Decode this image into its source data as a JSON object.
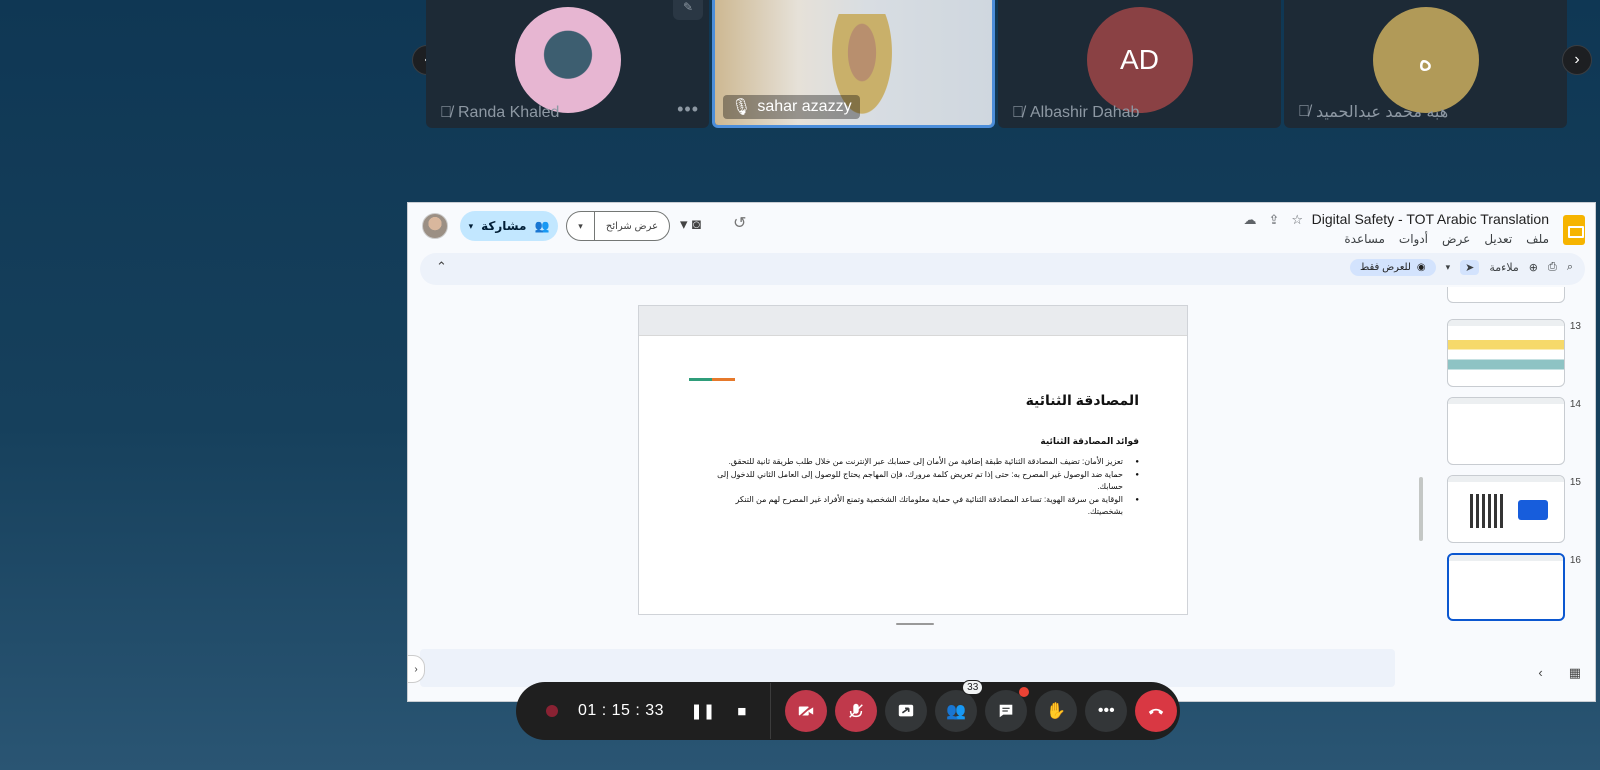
{
  "participants": [
    {
      "name": "Randa Khaled",
      "muted": true,
      "type": "photo"
    },
    {
      "name": "sahar azazzy",
      "muted": false,
      "type": "video",
      "active": true
    },
    {
      "name": "Albashir Dahab",
      "muted": true,
      "type": "initials",
      "initials": "AD",
      "color": "#8a4144"
    },
    {
      "name": "هبه محمد عبدالحميد",
      "muted": true,
      "type": "initials",
      "initials": "ه",
      "color": "#b19a58"
    }
  ],
  "slides_app": {
    "title": "Digital Safety - TOT Arabic Translation",
    "menu": [
      "ملف",
      "تعديل",
      "عرض",
      "أدوات",
      "مساعدة"
    ],
    "share_label": "مشاركة",
    "present_label": "عرض شرائح",
    "view_only_label": "للعرض فقط",
    "fit_label": "ملاءمة"
  },
  "slide": {
    "title": "المصادقة الثنائية",
    "subtitle": "فوائد المصادقة الثنائية",
    "bullets": [
      "تعزيز الأمان: تضيف المصادقة الثنائية طبقة إضافية من الأمان إلى حسابك عبر الإنترنت من خلال طلب طريقة ثانية للتحقق.",
      "حماية ضد الوصول غير المصرح به: حتى إذا تم تعريض كلمة مرورك، فإن المهاجم يحتاج للوصول إلى العامل الثاني للدخول إلى حسابك.",
      "الوقاية من سرقة الهوية: تساعد المصادقة الثنائية في حماية معلوماتك الشخصية وتمنع الأفراد غير المصرح لهم من التنكر بشخصيتك."
    ]
  },
  "filmstrip": [
    {
      "number": "",
      "selected": false
    },
    {
      "number": "13",
      "selected": false
    },
    {
      "number": "14",
      "selected": false
    },
    {
      "number": "15",
      "selected": false
    },
    {
      "number": "16",
      "selected": true
    }
  ],
  "meeting": {
    "timer": "01 : 15 : 33",
    "participants_count": "33"
  }
}
